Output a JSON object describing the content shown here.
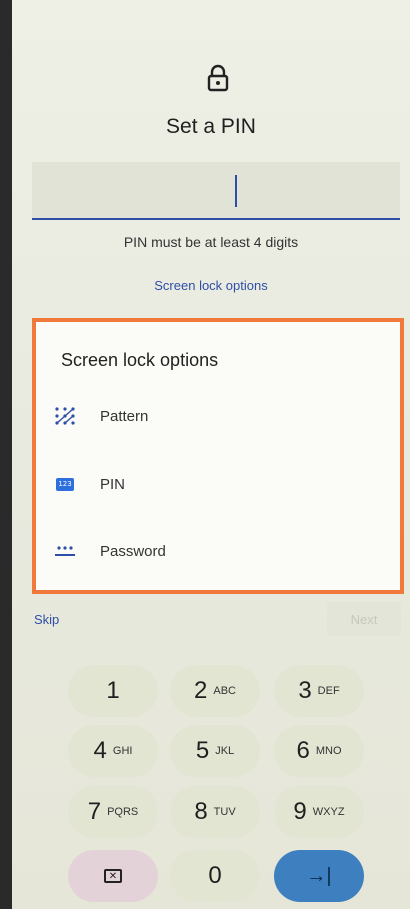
{
  "header": {
    "icon": "lock-icon",
    "title": "Set a PIN"
  },
  "pin_field": {
    "value": ""
  },
  "hint": "PIN must be at least 4 digits",
  "options_link": "Screen lock options",
  "dialog": {
    "title": "Screen lock options",
    "options": [
      {
        "label": "Pattern",
        "icon": "pattern-icon"
      },
      {
        "label": "PIN",
        "icon": "pin-123-icon",
        "badge": "123"
      },
      {
        "label": "Password",
        "icon": "password-icon"
      }
    ],
    "frame_color": "#f07a3c"
  },
  "footer": {
    "skip_label": "Skip",
    "next_label": "Next"
  },
  "keypad": {
    "keys": [
      {
        "num": "1",
        "sub": ""
      },
      {
        "num": "2",
        "sub": "ABC"
      },
      {
        "num": "3",
        "sub": "DEF"
      },
      {
        "num": "4",
        "sub": "GHI"
      },
      {
        "num": "5",
        "sub": "JKL"
      },
      {
        "num": "6",
        "sub": "MNO"
      },
      {
        "num": "7",
        "sub": "PQRS"
      },
      {
        "num": "8",
        "sub": "TUV"
      },
      {
        "num": "9",
        "sub": "WXYZ"
      },
      {
        "num": "0",
        "sub": ""
      }
    ],
    "delete_icon": "backspace-icon",
    "enter_icon": "enter-arrow-icon",
    "enter_symbol": "→|"
  },
  "colors": {
    "accent": "#2e4ea8",
    "enter_key": "#3d7fbf",
    "delete_key": "#e3d3d8"
  }
}
